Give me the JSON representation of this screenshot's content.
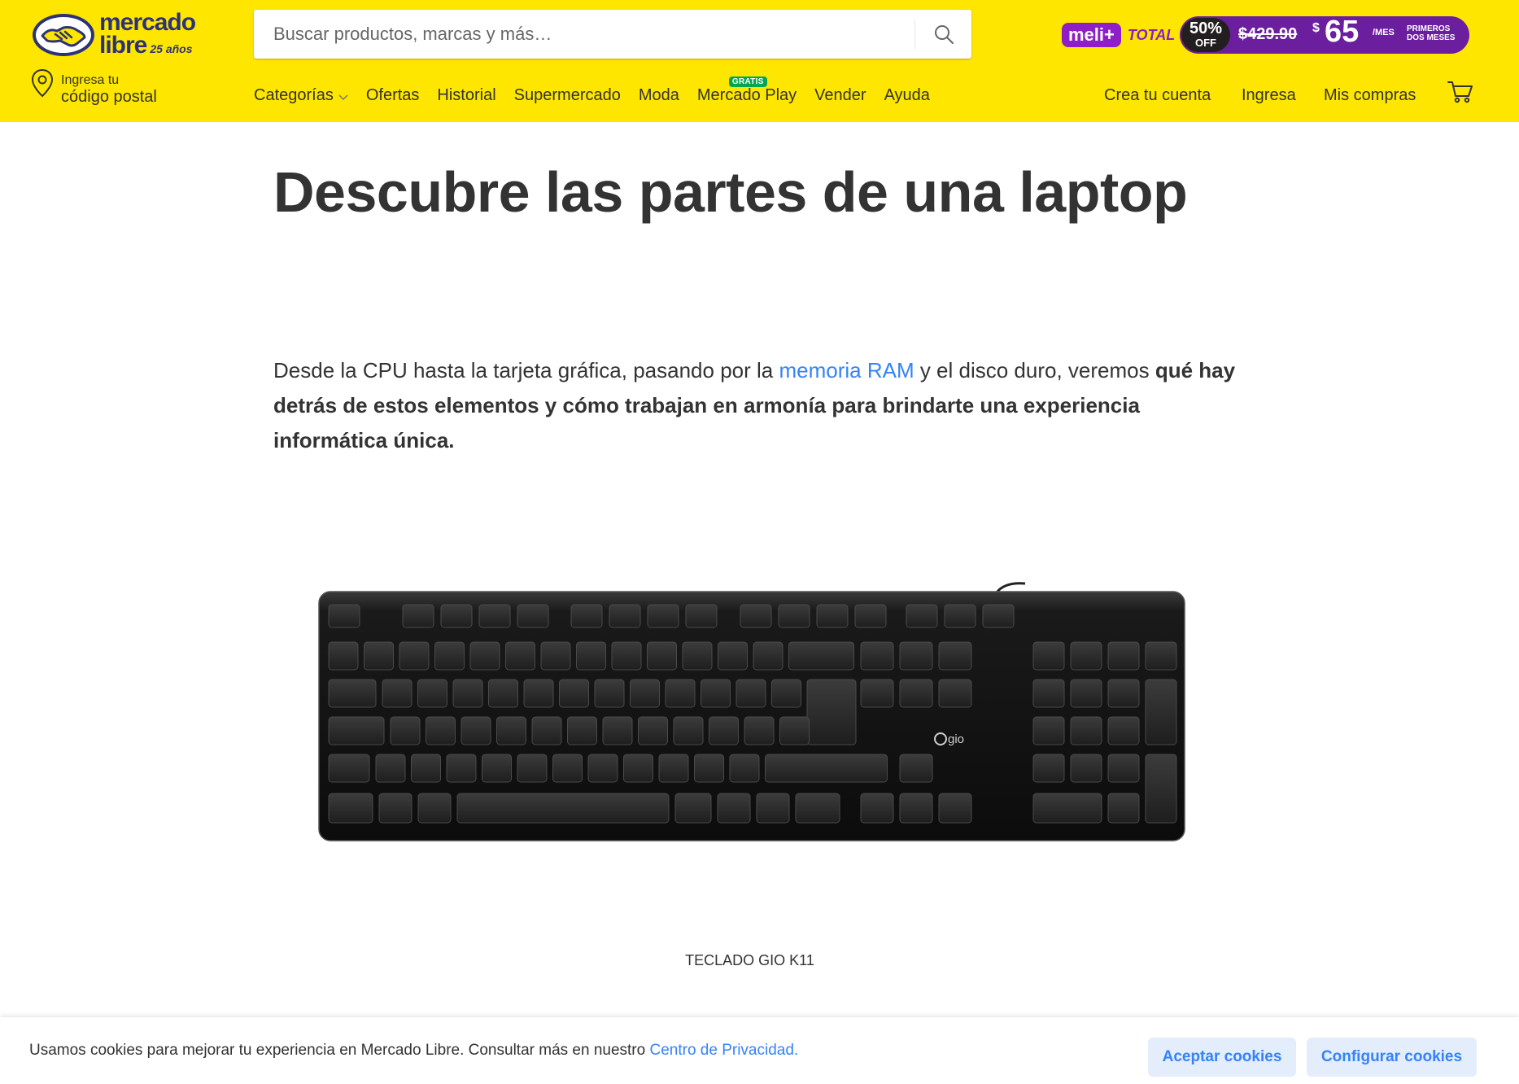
{
  "header": {
    "logo": {
      "line1": "mercado",
      "line2": "libre",
      "years": "25 años"
    },
    "search": {
      "placeholder": "Buscar productos, marcas y más…",
      "icon": "search-icon"
    },
    "meli": {
      "label": "meli+",
      "total": "TOTAL"
    },
    "promo": {
      "percent": "50%",
      "off": "OFF",
      "old_price": "$429.90",
      "currency": "$",
      "price": "65",
      "per": "/MES",
      "note": "PRIMEROS DOS MESES"
    },
    "location": {
      "line1": "Ingresa tu",
      "line2": "código postal",
      "icon": "location-pin-icon"
    },
    "nav": [
      {
        "label": "Categorías"
      },
      {
        "label": "Ofertas"
      },
      {
        "label": "Historial"
      },
      {
        "label": "Supermercado"
      },
      {
        "label": "Moda"
      },
      {
        "label": "Mercado Play",
        "badge": "GRATIS"
      },
      {
        "label": "Vender"
      },
      {
        "label": "Ayuda"
      }
    ],
    "account": {
      "create": "Crea tu cuenta",
      "login": "Ingresa",
      "purchases": "Mis compras",
      "cart_icon": "cart-icon"
    }
  },
  "article": {
    "title": "Descubre las partes de una laptop",
    "intro_pre": "Desde la CPU hasta la tarjeta gráfica, pasando por la ",
    "intro_link": "memoria RAM",
    "intro_mid": " y el disco duro, veremos ",
    "intro_bold": "qué hay detrás de estos elementos y cómo trabajan en armonía para brindarte una experiencia informática única.",
    "image_alt": "keyboard-image",
    "keyboard_brand": "gio",
    "caption": "TECLADO GIO K11"
  },
  "cookie": {
    "text": "Usamos cookies para mejorar tu experiencia en Mercado Libre. Consultar más en nuestro ",
    "link": "Centro de Privacidad.",
    "accept": "Aceptar cookies",
    "configure": "Configurar cookies"
  },
  "colors": {
    "header_bg": "#ffe600",
    "link": "#3483fa",
    "brand_navy": "#2d3277",
    "meli_purple": "#8f1ec6",
    "badge_green": "#00a650"
  }
}
